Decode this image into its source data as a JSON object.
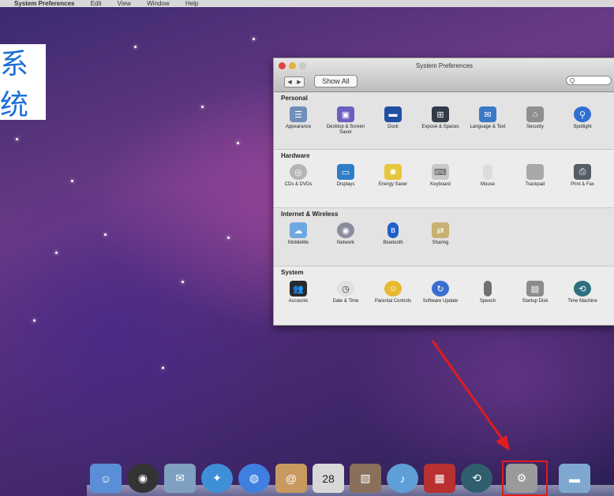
{
  "menubar": {
    "app": "System Preferences",
    "items": [
      "Edit",
      "View",
      "Window",
      "Help"
    ]
  },
  "overlay_text": "系统",
  "window": {
    "title": "System Preferences",
    "show_all": "Show All",
    "search_placeholder": "Q",
    "sections": [
      {
        "title": "Personal",
        "panes": [
          {
            "label": "Appearance",
            "icon": "appearance-icon",
            "color": "#6f8fb8"
          },
          {
            "label": "Desktop & Screen Saver",
            "icon": "desktop-icon",
            "color": "#6b5fbf"
          },
          {
            "label": "Dock",
            "icon": "dock-icon",
            "color": "#1f4fa0"
          },
          {
            "label": "Exposé & Spaces",
            "icon": "expose-icon",
            "color": "#333a48"
          },
          {
            "label": "Language & Text",
            "icon": "language-icon",
            "color": "#3c78c8"
          },
          {
            "label": "Security",
            "icon": "security-icon",
            "color": "#8f8f8f"
          },
          {
            "label": "Spotlight",
            "icon": "spotlight-icon",
            "color": "#2f6fd0"
          }
        ]
      },
      {
        "title": "Hardware",
        "panes": [
          {
            "label": "CDs & DVDs",
            "icon": "cd-icon",
            "color": "#b5b5b5"
          },
          {
            "label": "Displays",
            "icon": "displays-icon",
            "color": "#2f7fc8"
          },
          {
            "label": "Energy Saver",
            "icon": "energy-icon",
            "color": "#e6c63c"
          },
          {
            "label": "Keyboard",
            "icon": "keyboard-icon",
            "color": "#c8c8c8"
          },
          {
            "label": "Mouse",
            "icon": "mouse-icon",
            "color": "#dcdcdc"
          },
          {
            "label": "Trackpad",
            "icon": "trackpad-icon",
            "color": "#a8a8a8"
          },
          {
            "label": "Print & Fax",
            "icon": "print-icon",
            "color": "#555c66"
          }
        ]
      },
      {
        "title": "Internet & Wireless",
        "panes": [
          {
            "label": "MobileMe",
            "icon": "mobileme-icon",
            "color": "#6fa8e0"
          },
          {
            "label": "Network",
            "icon": "network-icon",
            "color": "#8c8ca0"
          },
          {
            "label": "Bluetooth",
            "icon": "bluetooth-icon",
            "color": "#1f5fc8"
          },
          {
            "label": "Sharing",
            "icon": "sharing-icon",
            "color": "#c8b070"
          }
        ]
      },
      {
        "title": "System",
        "panes": [
          {
            "label": "Accounts",
            "icon": "accounts-icon",
            "color": "#2a2a2a"
          },
          {
            "label": "Date & Time",
            "icon": "clock-icon",
            "color": "#e0e0e0"
          },
          {
            "label": "Parental Controls",
            "icon": "parental-icon",
            "color": "#e8b830"
          },
          {
            "label": "Software Update",
            "icon": "update-icon",
            "color": "#3a6fd0"
          },
          {
            "label": "Speech",
            "icon": "speech-icon",
            "color": "#707070"
          },
          {
            "label": "Startup Disk",
            "icon": "disk-icon",
            "color": "#8c8c8c"
          },
          {
            "label": "Time Machine",
            "icon": "timemachine-icon",
            "color": "#2f6f7f"
          }
        ]
      }
    ]
  },
  "dock": {
    "items": [
      {
        "name": "finder-icon",
        "color": "#5a8fd8"
      },
      {
        "name": "dashboard-icon",
        "color": "#333333"
      },
      {
        "name": "mail-icon",
        "color": "#7fa0c0"
      },
      {
        "name": "safari-icon",
        "color": "#3f8fd8"
      },
      {
        "name": "ichat-icon",
        "color": "#3f7fe0"
      },
      {
        "name": "address-book-icon",
        "color": "#c89a60"
      },
      {
        "name": "ical-icon",
        "color": "#d8d8d8",
        "text": "28"
      },
      {
        "name": "preview-icon",
        "color": "#8a6f5a"
      },
      {
        "name": "itunes-icon",
        "color": "#5f9fd8"
      },
      {
        "name": "photo-booth-icon",
        "color": "#b83030"
      },
      {
        "name": "time-machine-dock-icon",
        "color": "#2f5f6f"
      },
      {
        "name": "system-preferences-dock-icon",
        "color": "#9a9a9a"
      },
      {
        "name": "folder-icon",
        "color": "#7fa8d0"
      }
    ]
  }
}
